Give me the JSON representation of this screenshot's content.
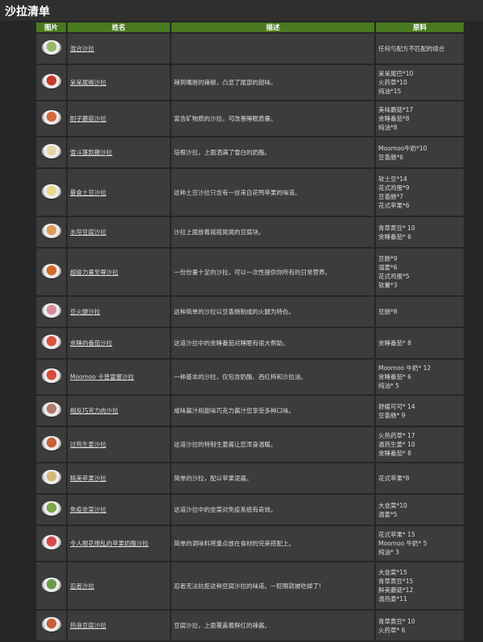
{
  "page_title": "沙拉清单",
  "headers": [
    "图片",
    "姓名",
    "描述",
    "原料"
  ],
  "rows": [
    {
      "name": "混合沙拉",
      "desc": "",
      "ingredients": [
        "任何与配方不匹配的组合"
      ],
      "color": "#9bb86a"
    },
    {
      "name": "呆呆尾椒沙拉",
      "desc": "辣到嘴唇的辣椒，凸显了尾部的甜味。",
      "ingredients": [
        "呆呆尾巴*10",
        "火药草*10",
        "纯油*15"
      ],
      "color": "#c43b2c"
    },
    {
      "name": "耐子蘑菇沙拉",
      "desc": "富含矿物质的沙拉，可改善睡眠质量。",
      "ingredients": [
        "美味蘑菇*17",
        "贪睡番茄*8",
        "纯油*8"
      ],
      "color": "#d06a3a"
    },
    {
      "name": "雪斗篷凯撒沙拉",
      "desc": "培根沙拉，上面洒满了雪白的奶酪。",
      "ingredients": [
        "Moomoo牛奶*10",
        "豆香肠*6"
      ],
      "color": "#e5d7a2"
    },
    {
      "name": "暴食土豆沙拉",
      "desc": "这种土豆沙拉只含有一丝来自花鸭苹果的味道。",
      "ingredients": [
        "软土豆*14",
        "花式鸡蛋*9",
        "豆香肠*7",
        "花式苹果*6"
      ],
      "color": "#e8d98a"
    },
    {
      "name": "水帘豆腐沙拉",
      "desc": "沙拉上面放着摇摇晃晃的豆腐块。",
      "ingredients": [
        "青草黄豆* 10",
        "贪睡番茄* 6"
      ],
      "color": "#e09a5a"
    },
    {
      "name": "超级力量至尊沙拉",
      "desc": "一份份量十足的沙拉，可以一次性提供你所有的日常营养。",
      "ingredients": [
        "豆肠*9",
        "溺姜*6",
        "花式鸡蛋*5",
        "软薯*3"
      ],
      "color": "#cf6a2a"
    },
    {
      "name": "豆火腿沙拉",
      "desc": "这种简单的沙拉以豆香肠制成的火腿为特色。",
      "ingredients": [
        "豆肠*8"
      ],
      "color": "#d98a9a"
    },
    {
      "name": "贪睡的番茄沙拉",
      "desc": "这道沙拉中的贪睡番茄对睡眠有很大帮助。",
      "ingredients": [
        "贪睡番茄* 8"
      ],
      "color": "#d9543a"
    },
    {
      "name": "Moomoo 卡普雷塞沙拉",
      "desc": "一种基本的沙拉，仅包含奶酪、西红柿和沙拉油。",
      "ingredients": [
        "Moomoo 牛奶* 12",
        "贪睡番茄* 6",
        "纯油* 5"
      ],
      "color": "#d84a3a"
    },
    {
      "name": "相反巧克力肉沙拉",
      "desc": "咸味酱汁和甜味巧克力酱汁您享受多种口味。",
      "ingredients": [
        "舒缓可可* 14",
        "豆香肠* 9"
      ],
      "color": "#b07a6a"
    },
    {
      "name": "过热生姜沙拉",
      "desc": "这道沙拉的特制生姜酱让您浑身温暖。",
      "ingredients": [
        "火热药草* 17",
        "温热生姜* 10",
        "贪睡番茄* 8"
      ],
      "color": "#c8603a"
    },
    {
      "name": "精美苹果沙拉",
      "desc": "简单的沙拉，配以苹果泥酱。",
      "ingredients": [
        "花式苹果*8"
      ],
      "color": "#d8b87a"
    },
    {
      "name": "免疫韭菜沙拉",
      "desc": "这道沙拉中的韭菜对免疫系统有奇效。",
      "ingredients": [
        "大韭菜*10",
        "温姜*5"
      ],
      "color": "#7aa84a"
    },
    {
      "name": "令人眼花缭乱的苹果奶酪沙拉",
      "desc": "简单的调味料将重点放在食材的完美搭配上。",
      "ingredients": [
        "花式苹果* 15",
        "Moomoo 牛奶* 5",
        "纯油* 3"
      ],
      "color": "#d84a4a"
    },
    {
      "name": "忍者沙拉",
      "desc": "忍者无法抗拒这种豆腐沙拉的味道。一眨眼就被吃掉了!",
      "ingredients": [
        "大韭菜*15",
        "青草黄豆*15",
        "鲜美蘑菇*12",
        "温热姜*11"
      ],
      "color": "#6a9a4a"
    },
    {
      "name": "热浪豆腐沙拉",
      "desc": "豆腐沙拉，上面覆盖着鲜红的辣酱。",
      "ingredients": [
        "青草黄豆* 10",
        "火药草* 6"
      ],
      "color": "#c8603a"
    }
  ]
}
